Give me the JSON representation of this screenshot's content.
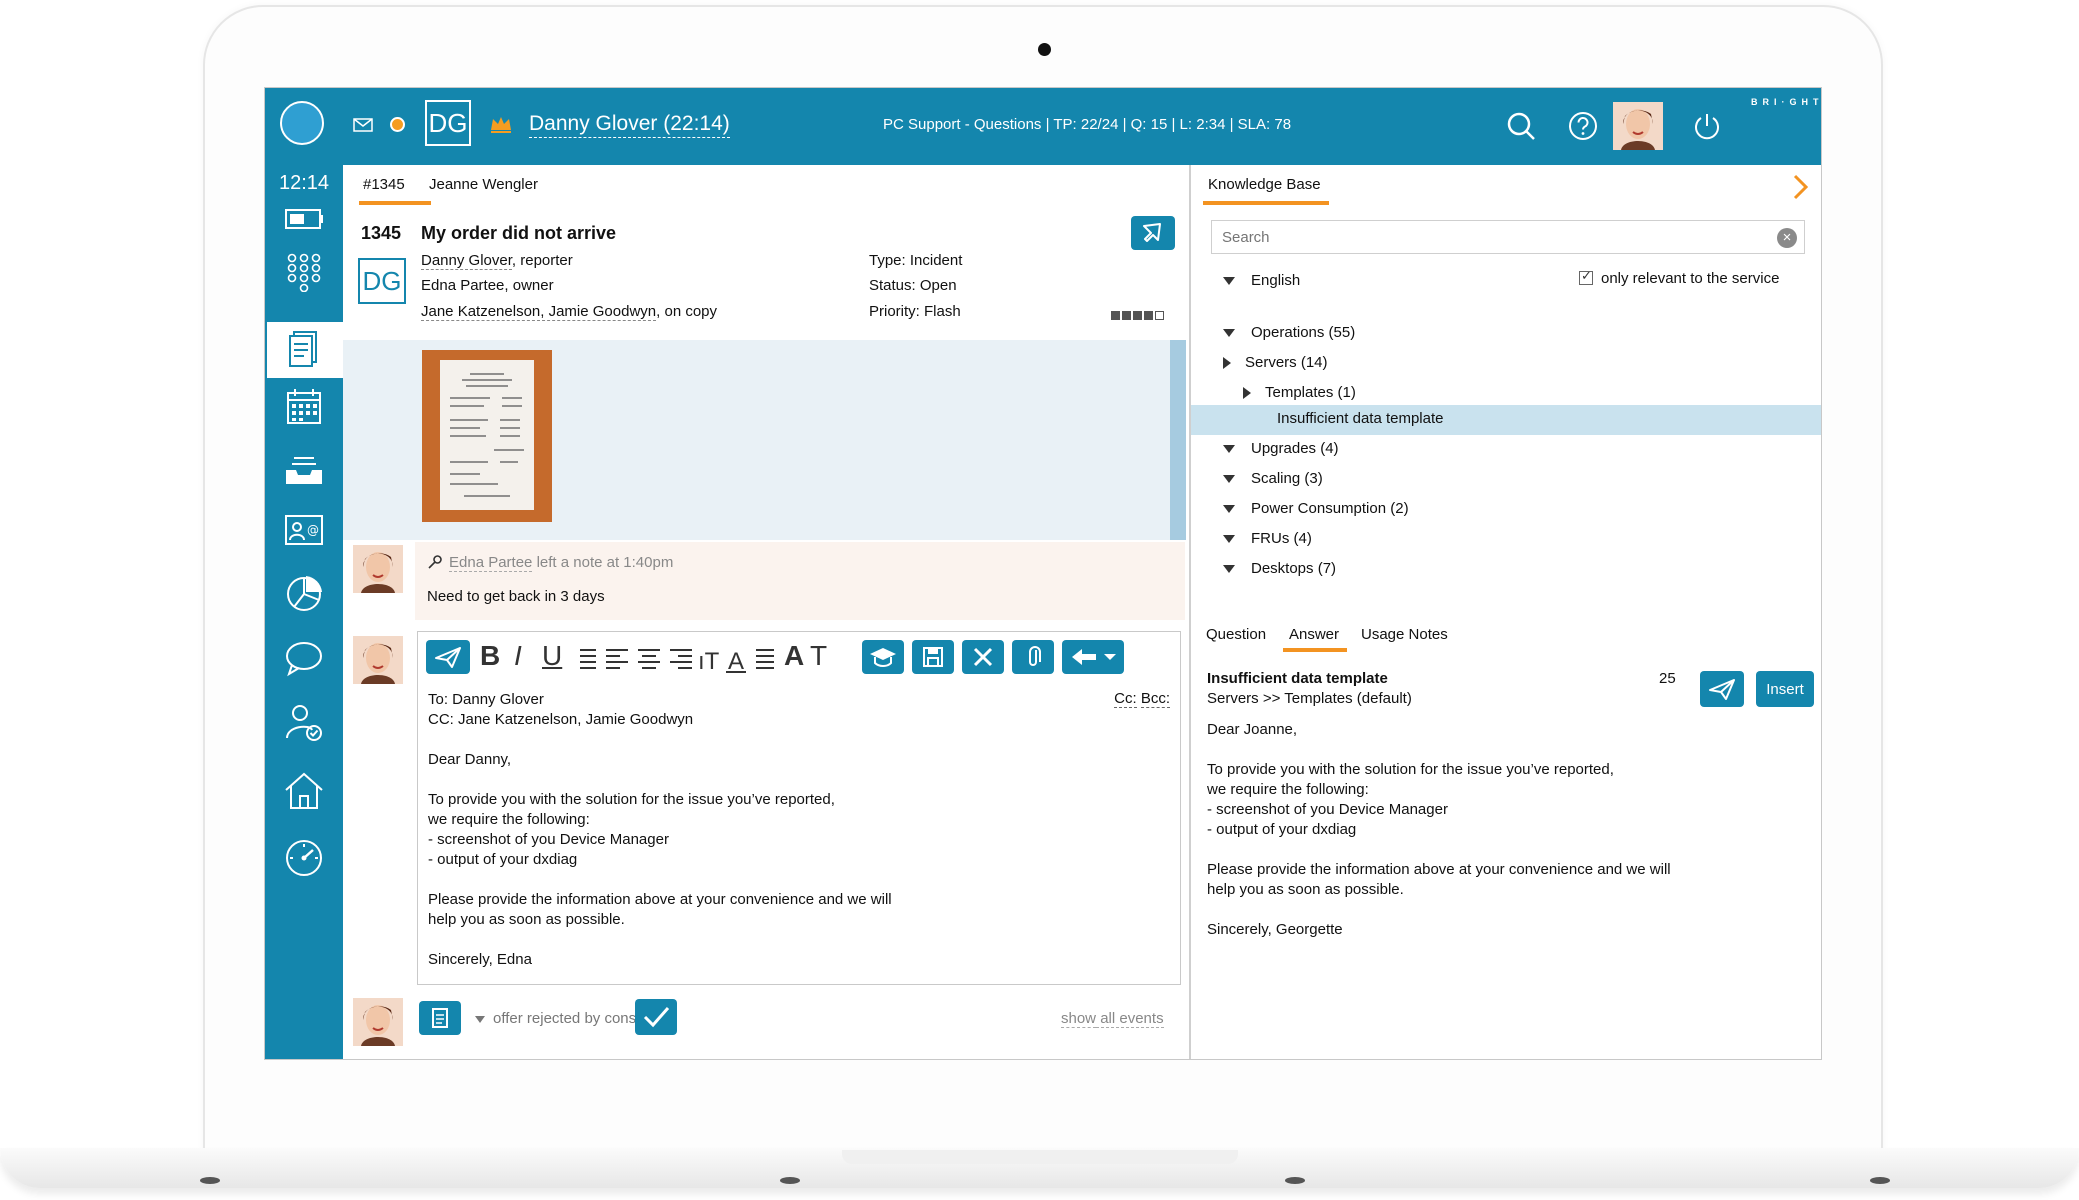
{
  "topbar": {
    "agent_initials": "DG",
    "agent_name": "Danny Glover (22:14)",
    "queue_info": "PC Support - Questions  |  TP: 22/24  |  Q: 15  |  L: 2:34  |  SLA: 78",
    "brand": "BRI·GHT·PAT·TERN",
    "accent_color": "#1486ad",
    "status_color": "#f59d21"
  },
  "sidebar": {
    "clock": "12:14",
    "icons": [
      "battery-icon",
      "dialpad-icon",
      "document-icon",
      "calendar-icon",
      "inbox-icon",
      "contact-card-icon",
      "pie-chart-icon",
      "chat-icon",
      "user-check-icon",
      "home-icon",
      "gauge-icon"
    ]
  },
  "ticket": {
    "tab_label": "#1345",
    "customer": "Jeanne Wengler",
    "number": "1345",
    "subject": "My order did not arrive",
    "participant_initials": "DG",
    "reporter_name": "Danny Glover",
    "reporter_role": ", reporter",
    "owner_name": "Edna Partee",
    "owner_role": ", owner",
    "copy_names": "Jane Katzenelson, Jamie Goodwyn",
    "copy_role": ", on copy",
    "type": "Type: Incident",
    "status": "Status: Open",
    "priority": "Priority: Flash"
  },
  "note": {
    "author": "Edna Partee",
    "meta": " left a note at 1:40pm",
    "text": "Need to get back in 3 days"
  },
  "editor": {
    "formatting": [
      "B",
      "I",
      "U"
    ],
    "cc_label": "Cc:",
    "bcc_label": "Bcc:",
    "body": "To: Danny Glover\nCC: Jane Katzenelson, Jamie Goodwyn\n\nDear Danny,\n\nTo provide you with the solution for the issue you’ve reported,\nwe require the following:\n- screenshot of you Device Manager\n- output of your dxdiag\n\nPlease provide the information above at your convenience and we will\nhelp you as soon as possible.\n\nSincerely, Edna"
  },
  "events": {
    "offer_text": "offer rejected by consumer",
    "show_word": "show",
    "show_rest": " all events"
  },
  "kb": {
    "title": "Knowledge Base",
    "search_placeholder": "Search",
    "language": "English",
    "only_relevant": "only relevant to the service",
    "tree": {
      "operations": "Operations (55)",
      "servers": "Servers (14)",
      "templates": "Templates (1)",
      "insufficient": "Insufficient data template",
      "upgrades": "Upgrades (4)",
      "scaling": "Scaling (3)",
      "power": "Power Consumption (2)",
      "frus": "FRUs (4)",
      "desktops": "Desktops (7)"
    },
    "tabs": {
      "question": "Question",
      "answer": "Answer",
      "usage": "Usage Notes"
    },
    "answer": {
      "title": "Insufficient data template",
      "path": "Servers >> Templates (default)",
      "count": "25",
      "insert_label": "Insert",
      "body": "Dear Joanne,\n\nTo provide you with the solution for the issue you’ve reported,\nwe require the following:\n- screenshot of you Device Manager\n- output of your dxdiag\n\nPlease provide the information above at your convenience and we will\nhelp you as soon as possible.\n\nSincerely, Georgette"
    }
  }
}
